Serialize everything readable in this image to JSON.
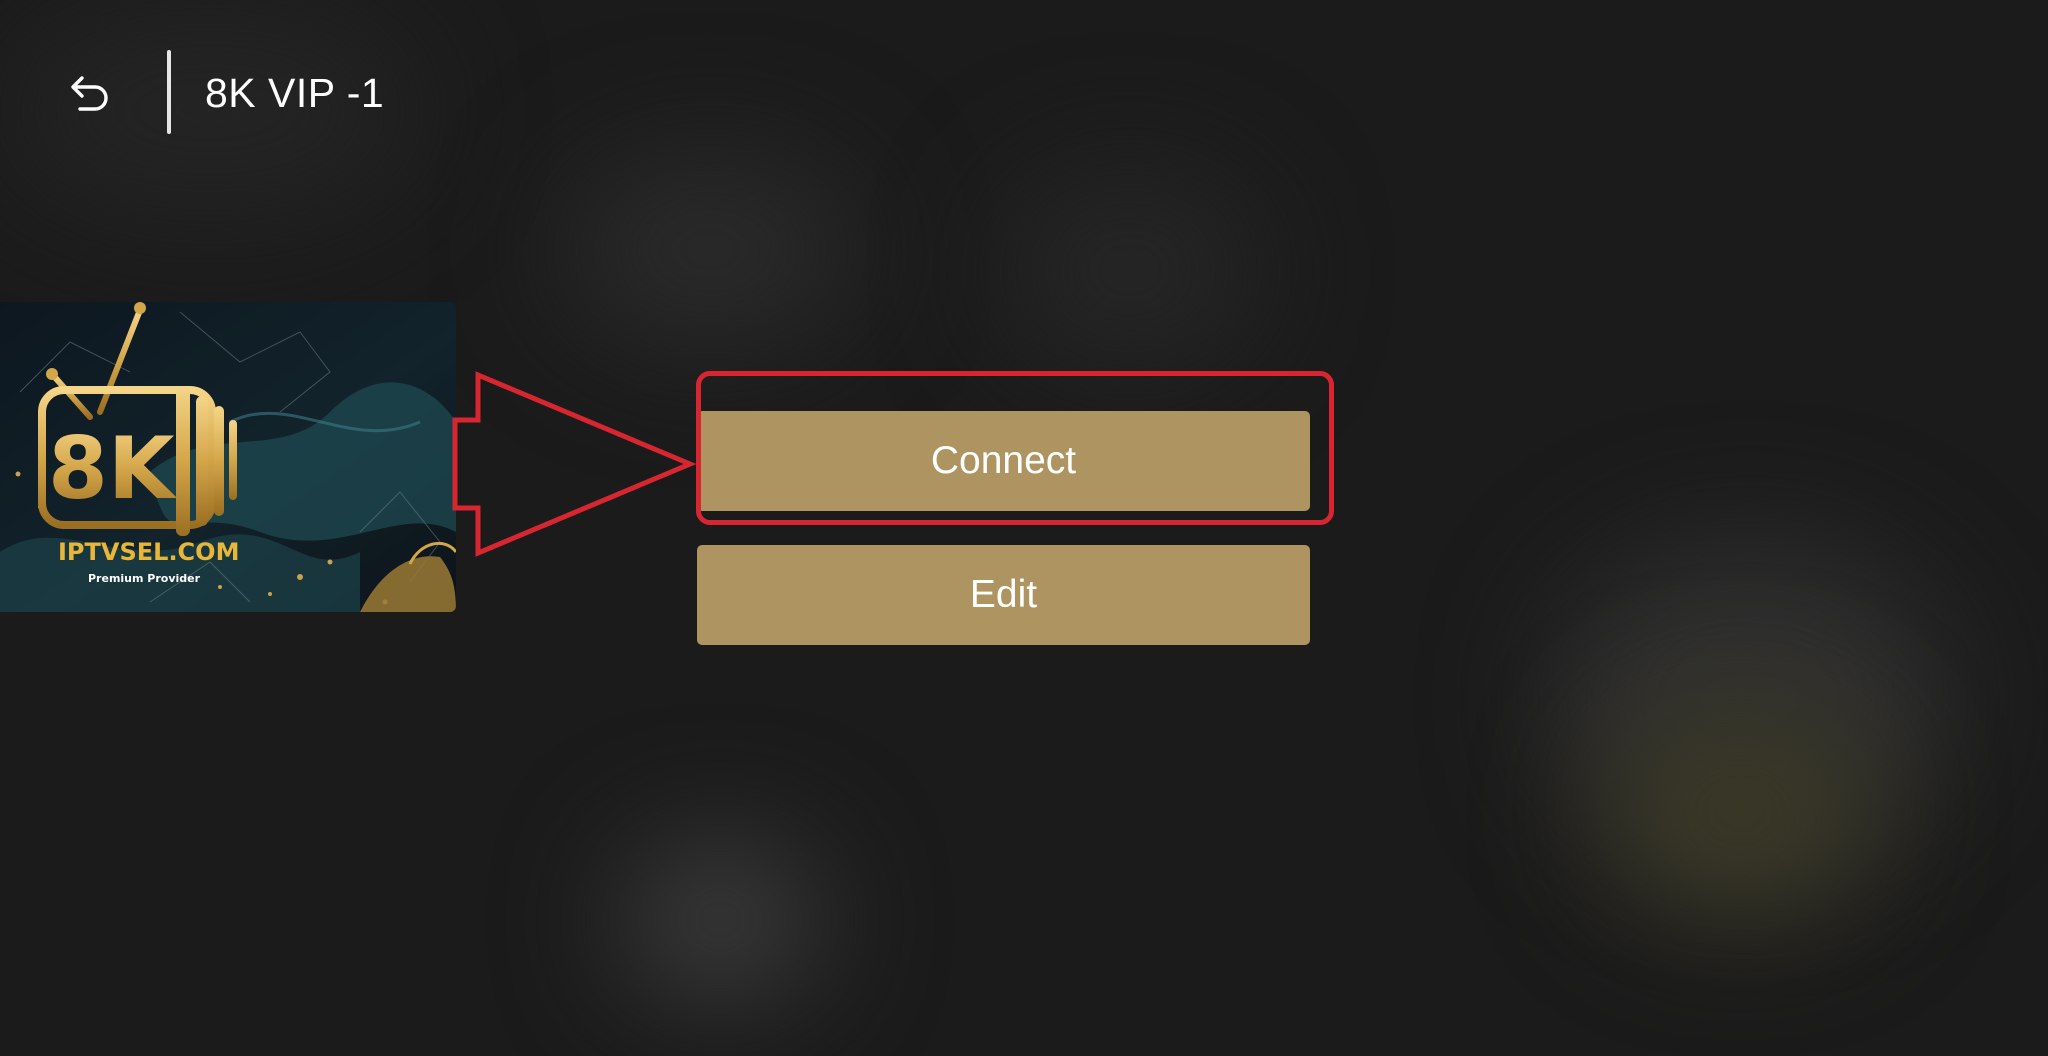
{
  "header": {
    "back_icon": "back-arrow-icon",
    "title": "8K VIP -1"
  },
  "thumbnail": {
    "logo_text": "8K",
    "brand_text": "IPTVSEL.COM",
    "tagline": "Premium Provider"
  },
  "actions": {
    "connect_label": "Connect",
    "edit_label": "Edit"
  },
  "colors": {
    "background": "#1b1b1b",
    "button": "#ad9460",
    "focus_highlight": "#d82630",
    "logo_gold": "#d4a64a"
  }
}
